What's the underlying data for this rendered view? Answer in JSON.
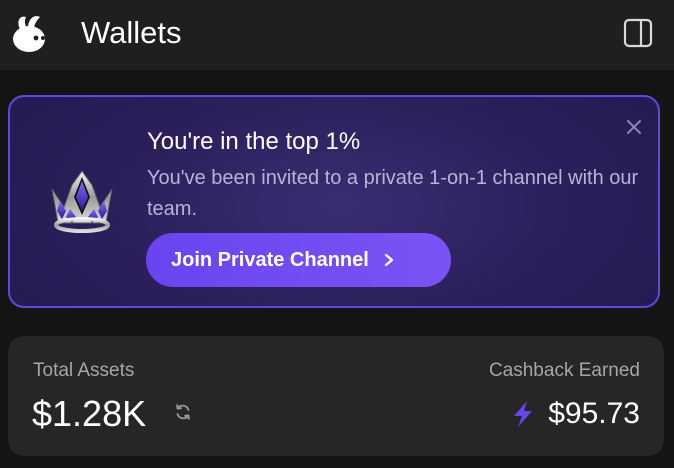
{
  "header": {
    "title": "Wallets",
    "logo_icon": "rabbit-logo-icon",
    "panel_icon": "sidebar-panel-icon"
  },
  "banner": {
    "title": "You're in the top 1%",
    "description": "You've been invited to a private 1-on-1 channel with our team.",
    "button_label": "Join Private Channel",
    "crown_icon": "crown-icon",
    "close_icon": "close-icon",
    "accent_color": "#6a44f0"
  },
  "summary": {
    "total_assets_label": "Total Assets",
    "total_assets_value": "$1.28K",
    "cashback_label": "Cashback Earned",
    "cashback_value": "$95.73",
    "bolt_color": "#6a44f0"
  }
}
